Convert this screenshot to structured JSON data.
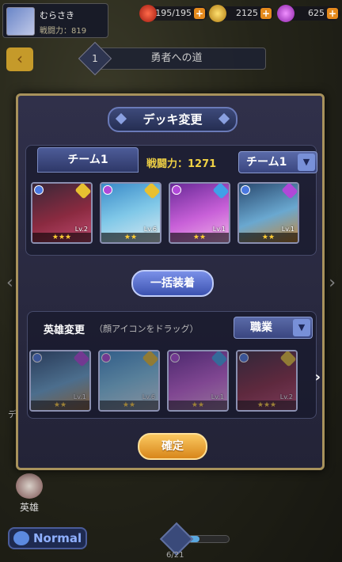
{
  "player": {
    "name": "むらさき",
    "power_label": "戦闘力：819"
  },
  "resources": [
    {
      "icon": "stamina-icon",
      "value": "195/195",
      "color": "#d23a2a"
    },
    {
      "icon": "gold-icon",
      "value": "2125",
      "color": "#d8a830"
    },
    {
      "icon": "gem-icon",
      "value": "625",
      "color": "#c24ad8"
    }
  ],
  "stage": {
    "number": "1",
    "title": "勇者への道"
  },
  "side": {
    "deck_label": "デッキ",
    "hero_label": "英雄"
  },
  "mode_button": "Normal",
  "progress": {
    "text": "6/21",
    "fraction": 0.29
  },
  "modal": {
    "title": "デッキ変更",
    "team_tab": "チーム1",
    "power": "戦闘力：1271",
    "team_select": "チーム1",
    "equip_all": "一括装着",
    "hero_change": "英雄変更",
    "hero_hint": "（顔アイコンをドラッグ）",
    "job_select": "職業",
    "confirm": "確定"
  },
  "team_cards": [
    {
      "name": "dark-horned-girl",
      "lv": "Lv.2",
      "stars": "★★★",
      "elem": "#4a78e0",
      "cls": "#e8c030",
      "art": "linear-gradient(160deg,#3a2838,#8a2a40 55%,#c04a70)"
    },
    {
      "name": "witch-girl",
      "lv": "Lv.6",
      "stars": "★★",
      "elem": "#b048d8",
      "cls": "#e8c030",
      "art": "linear-gradient(160deg,#3a8ac8,#80c8e8 50%,#d8e8f0)"
    },
    {
      "name": "purple-twin-tail-girl",
      "lv": "Lv.1",
      "stars": "★★",
      "elem": "#b048d8",
      "cls": "#40a0e8",
      "art": "linear-gradient(160deg,#6a2a98,#c860d8 55%,#f0b0e8)"
    },
    {
      "name": "wolf-warrior",
      "lv": "Lv.1",
      "stars": "★★",
      "elem": "#4a78e0",
      "cls": "#b048d8",
      "art": "linear-gradient(160deg,#2a4a70,#6aa8d0 55%,#c8883a)"
    }
  ],
  "hero_cards": [
    {
      "name": "wolf-warrior",
      "lv": "Lv.1",
      "stars": "★★",
      "elem": "#4a78e0",
      "cls": "#b048d8",
      "art": "linear-gradient(160deg,#2a4a70,#6aa8d0 55%,#c8883a)"
    },
    {
      "name": "witch-girl",
      "lv": "Lv.6",
      "stars": "★★",
      "elem": "#b048d8",
      "cls": "#e8c030",
      "art": "linear-gradient(160deg,#3a8ac8,#80c8e8 50%,#d8e8f0)"
    },
    {
      "name": "purple-twin-tail-girl",
      "lv": "Lv.1",
      "stars": "★★",
      "elem": "#b048d8",
      "cls": "#40a0e8",
      "art": "linear-gradient(160deg,#6a2a98,#c860d8 55%,#f0b0e8)"
    },
    {
      "name": "dark-horned-girl",
      "lv": "Lv.2",
      "stars": "★★★",
      "elem": "#4a78e0",
      "cls": "#e8c030",
      "art": "linear-gradient(160deg,#3a2838,#8a2a40 55%,#c04a70)"
    }
  ]
}
